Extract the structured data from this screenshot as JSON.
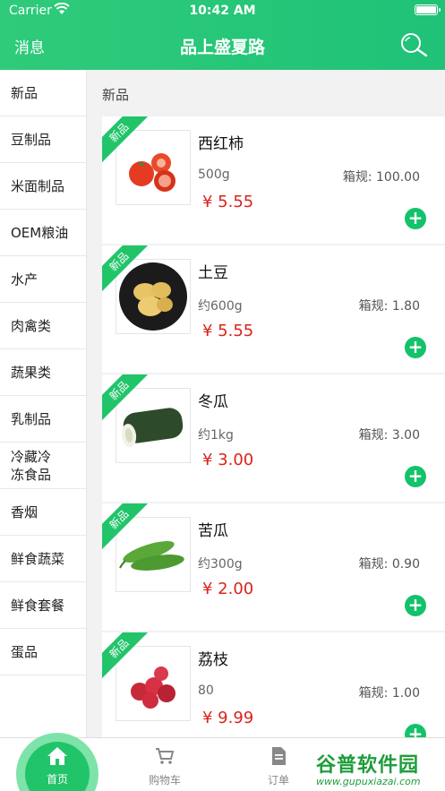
{
  "status_bar": {
    "carrier": "Carrier",
    "time": "10:42 AM"
  },
  "header": {
    "left_label": "消息",
    "title": "品上盛夏路",
    "search_icon": "search-icon"
  },
  "sidebar": {
    "items": [
      {
        "label": "新品"
      },
      {
        "label": "豆制品"
      },
      {
        "label": "米面制品"
      },
      {
        "label": "OEM粮油"
      },
      {
        "label": "水产"
      },
      {
        "label": "肉禽类"
      },
      {
        "label": "蔬果类"
      },
      {
        "label": "乳制品"
      },
      {
        "label": "冷藏冷冻食品"
      },
      {
        "label": "香烟"
      },
      {
        "label": "鲜食蔬菜"
      },
      {
        "label": "鲜食套餐"
      },
      {
        "label": "蛋品"
      }
    ]
  },
  "main": {
    "section_title": "新品",
    "products": [
      {
        "ribbon": "新品",
        "name": "西红柿",
        "spec": "500g",
        "box": "箱规: 100.00",
        "price": "¥ 5.55",
        "image": "tomato"
      },
      {
        "ribbon": "新品",
        "name": "土豆",
        "spec": "约600g",
        "box": "箱规: 1.80",
        "price": "¥ 5.55",
        "image": "potato"
      },
      {
        "ribbon": "新品",
        "name": "冬瓜",
        "spec": "约1kg",
        "box": "箱规: 3.00",
        "price": "¥ 3.00",
        "image": "winter-melon"
      },
      {
        "ribbon": "新品",
        "name": "苦瓜",
        "spec": "约300g",
        "box": "箱规: 0.90",
        "price": "¥ 2.00",
        "image": "bitter-melon"
      },
      {
        "ribbon": "新品",
        "name": "荔枝",
        "spec": "80",
        "box": "箱规: 1.00",
        "price": "¥ 9.99",
        "image": "lychee"
      }
    ]
  },
  "tabbar": {
    "tabs": [
      {
        "label": "首页",
        "icon": "home-icon"
      },
      {
        "label": "购物车",
        "icon": "cart-icon"
      },
      {
        "label": "订单",
        "icon": "document-icon"
      }
    ]
  },
  "watermark": {
    "text": "谷普软件园",
    "url": "www.gupuxiazai.com"
  },
  "colors": {
    "brand": "#22c46a",
    "price": "#d9241c"
  }
}
